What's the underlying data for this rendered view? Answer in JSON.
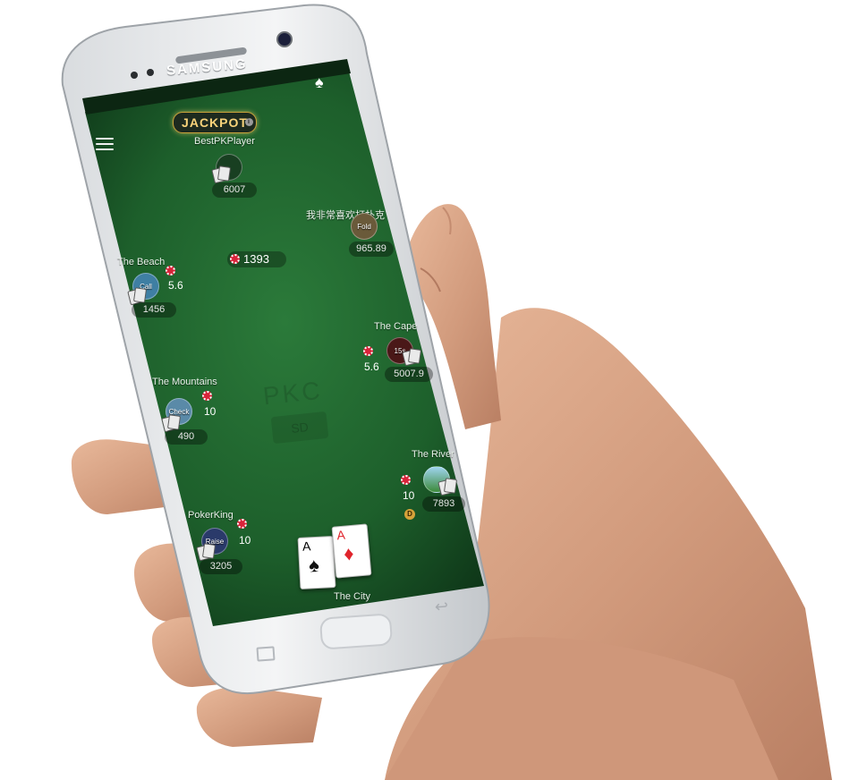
{
  "device": {
    "brand": "SAMSUNG"
  },
  "header": {
    "jackpot_label": "JACKPOT",
    "jackpot_info": "i"
  },
  "pot": {
    "amount": "1393"
  },
  "players": [
    {
      "name": "BestPKPlayer",
      "stack": "6007",
      "action": "",
      "bet": ""
    },
    {
      "name": "我非常喜欢打扑克",
      "stack": "965.89",
      "action": "Fold",
      "bet": ""
    },
    {
      "name": "The Beach",
      "stack": "1456",
      "action": "Call",
      "bet": "5.6"
    },
    {
      "name": "The Cape",
      "stack": "5007.9",
      "action": "15s",
      "bet": "5.6"
    },
    {
      "name": "The Mountains",
      "stack": "490",
      "action": "Check",
      "bet": "10"
    },
    {
      "name": "The River",
      "stack": "7893",
      "action": "",
      "bet": "10"
    },
    {
      "name": "PokerKing",
      "stack": "3205",
      "action": "Raise",
      "bet": "10"
    },
    {
      "name": "The City",
      "stack": "",
      "action": "",
      "bet": ""
    }
  ],
  "hole_cards": [
    {
      "rank": "A",
      "suit": "♠",
      "color": "#111111"
    },
    {
      "rank": "A",
      "suit": "♦",
      "color": "#e0242c"
    }
  ],
  "table": {
    "watermark_logo": "PKC",
    "watermark_sd": "SD",
    "dealer_label": "D"
  },
  "icons": [
    "menu-icon",
    "spade-icon",
    "chip-icon",
    "dealer-button-icon"
  ],
  "colors": {
    "felt": "#1e6a2c",
    "felt_dark": "#0a2b12",
    "chip": "#d8243a",
    "jackpot_gold": "#f8d37a"
  }
}
